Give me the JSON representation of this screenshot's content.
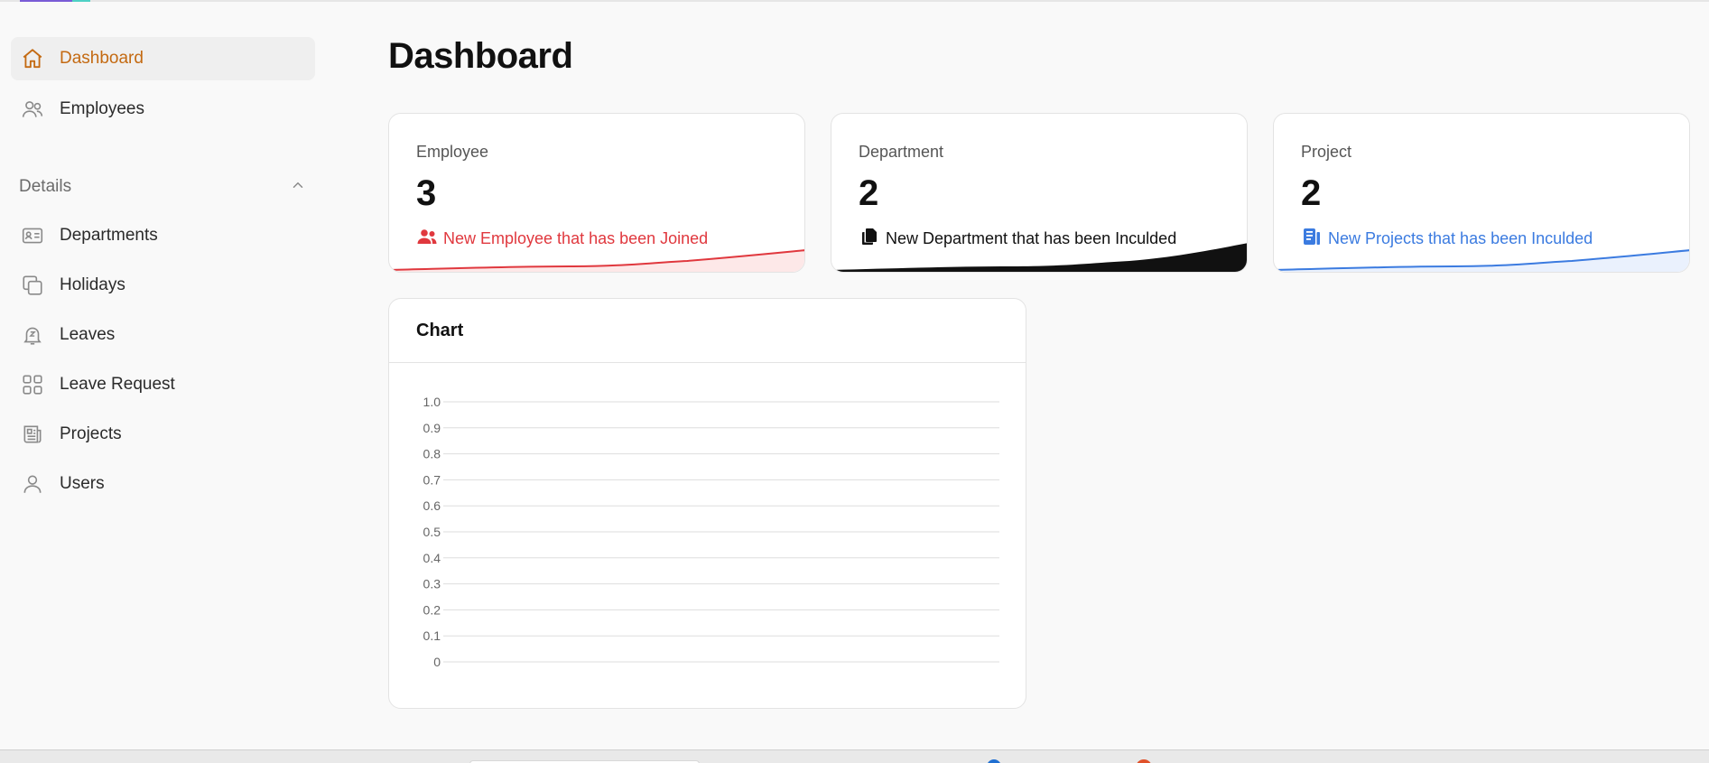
{
  "sidebar": {
    "items": [
      {
        "label": "Dashboard",
        "icon": "home-icon",
        "active": true
      },
      {
        "label": "Employees",
        "icon": "users-icon",
        "active": false
      }
    ],
    "section": {
      "label": "Details",
      "expanded": true
    },
    "details_items": [
      {
        "label": "Departments",
        "icon": "id-card-icon"
      },
      {
        "label": "Holidays",
        "icon": "copy-icon"
      },
      {
        "label": "Leaves",
        "icon": "bell-z-icon"
      },
      {
        "label": "Leave Request",
        "icon": "grid-icon"
      },
      {
        "label": "Projects",
        "icon": "newspaper-icon"
      },
      {
        "label": "Users",
        "icon": "user-icon"
      }
    ]
  },
  "main": {
    "title": "Dashboard",
    "cards": [
      {
        "title": "Employee",
        "value": "3",
        "subtitle": "New Employee that has been Joined",
        "color": "#e0383e",
        "icon": "users-solid-icon"
      },
      {
        "title": "Department",
        "value": "2",
        "subtitle": "New Department that has been Inculded",
        "color": "#111111",
        "icon": "files-solid-icon"
      },
      {
        "title": "Project",
        "value": "2",
        "subtitle": "New Projects that has been Inculded",
        "color": "#3b7be0",
        "icon": "book-solid-icon"
      }
    ],
    "chart": {
      "title": "Chart"
    }
  },
  "chart_data": {
    "type": "line",
    "title": "Chart",
    "x": [],
    "series": [],
    "ylim": [
      0,
      1.0
    ],
    "yticks": [
      "1.0",
      "0.9",
      "0.8",
      "0.7",
      "0.6",
      "0.5",
      "0.4",
      "0.3",
      "0.2",
      "0.1",
      "0"
    ],
    "grid": true
  },
  "colors": {
    "accent": "#c46a12",
    "active_bg": "#efefef",
    "page_bg": "#f9f9f9"
  }
}
